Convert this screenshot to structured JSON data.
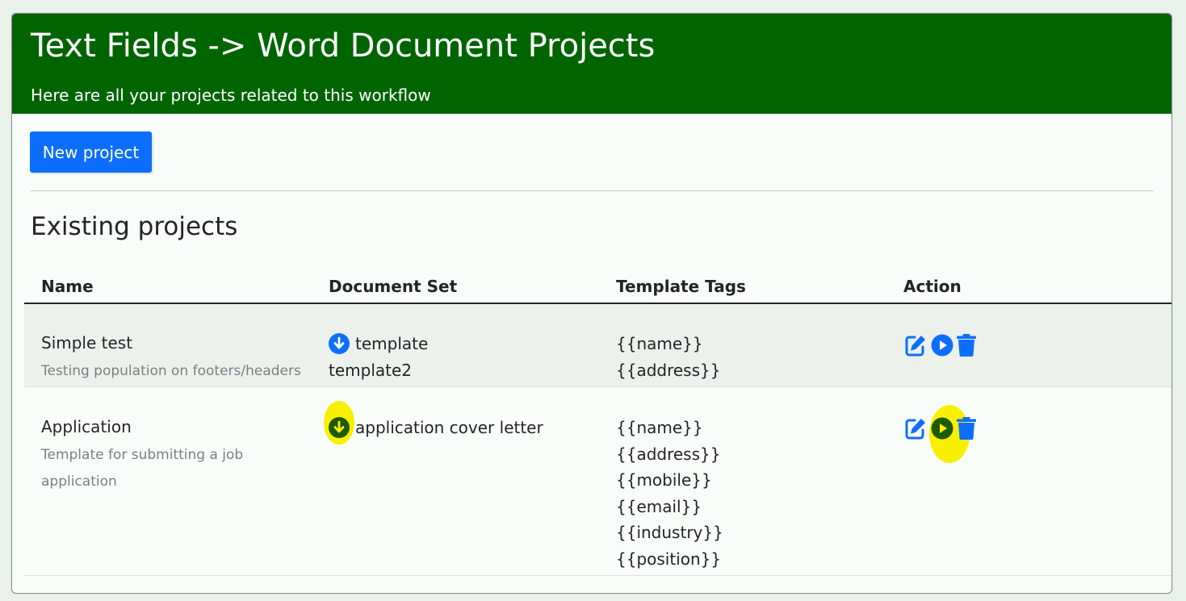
{
  "header": {
    "title": "Text Fields -> Word Document Projects",
    "subtitle": "Here are all your projects related to this workflow"
  },
  "toolbar": {
    "new_project_label": "New project"
  },
  "section": {
    "title": "Existing projects"
  },
  "table": {
    "columns": [
      "Name",
      "Document Set",
      "Template Tags",
      "Action"
    ],
    "rows": [
      {
        "name": "Simple test",
        "description": "Testing population on footers/headers",
        "documents": [
          "template",
          "template2"
        ],
        "tags": [
          "{{name}}",
          "{{address}}"
        ]
      },
      {
        "name": "Application",
        "description": "Template for submitting a job application",
        "documents": [
          "application cover letter"
        ],
        "tags": [
          "{{name}}",
          "{{address}}",
          "{{mobile}}",
          "{{email}}",
          "{{industry}}",
          "{{position}}"
        ]
      }
    ]
  },
  "icons": {
    "download": "download-circle-icon",
    "edit": "edit-icon",
    "run": "play-circle-icon",
    "delete": "trash-icon"
  },
  "colors": {
    "header_bg": "#006400",
    "primary": "#0d6efd",
    "highlight": "#f8f000",
    "highlighted_icon": "#1e5a00"
  }
}
